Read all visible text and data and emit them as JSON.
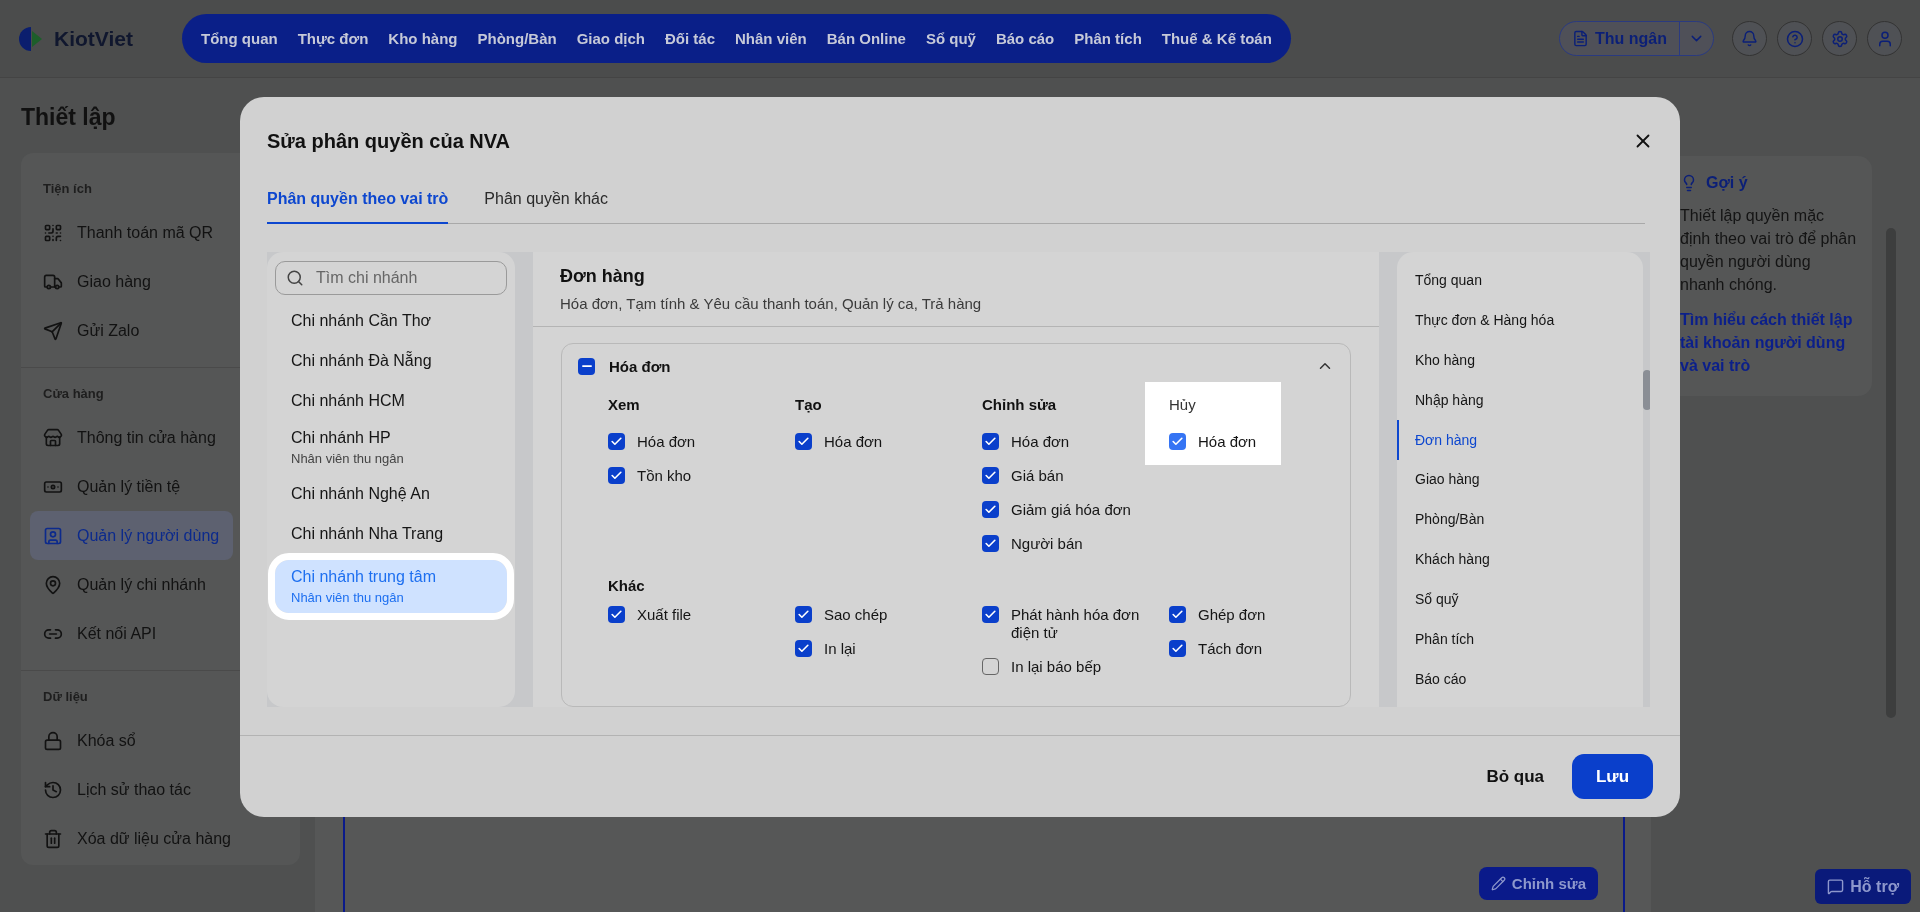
{
  "header": {
    "logo": "KiotViet",
    "nav": [
      "Tổng quan",
      "Thực đơn",
      "Kho hàng",
      "Phòng/Bàn",
      "Giao dịch",
      "Đối tác",
      "Nhân viên",
      "Bán Online",
      "Sổ quỹ",
      "Báo cáo",
      "Phân tích",
      "Thuế & Kế toán"
    ],
    "role_button": "Thu ngân"
  },
  "page": {
    "title": "Thiết lập",
    "sidebar": [
      {
        "title": "Tiện ích",
        "items": [
          {
            "label": "Thanh toán mã QR",
            "selected": false
          },
          {
            "label": "Giao hàng",
            "selected": false
          },
          {
            "label": "Gửi Zalo",
            "selected": false
          }
        ]
      },
      {
        "title": "Cửa hàng",
        "items": [
          {
            "label": "Thông tin cửa hàng",
            "selected": false
          },
          {
            "label": "Quản lý tiền tệ",
            "selected": false
          },
          {
            "label": "Quản lý người dùng",
            "selected": true
          },
          {
            "label": "Quản lý chi nhánh",
            "selected": false
          },
          {
            "label": "Kết nối API",
            "selected": false
          }
        ]
      },
      {
        "title": "Dữ liệu",
        "items": [
          {
            "label": "Khóa sổ",
            "selected": false
          },
          {
            "label": "Lịch sử thao tác",
            "selected": false
          },
          {
            "label": "Xóa dữ liệu cửa hàng",
            "selected": false
          }
        ]
      }
    ],
    "edit_button": "Chỉnh sửa",
    "hint": {
      "title": "Gợi ý",
      "text": "Thiết lập quyền mặc định theo vai trò để phân quyền người dùng nhanh chóng.",
      "link": "Tìm hiểu cách thiết lập tài khoản người dùng và vai trò"
    },
    "support_button": "Hỗ trợ"
  },
  "modal": {
    "title": "Sửa phân quyền của NVA",
    "tabs": [
      {
        "label": "Phân quyền theo vai trò",
        "selected": true
      },
      {
        "label": "Phân quyền khác",
        "selected": false
      }
    ],
    "search": {
      "placeholder": "Tìm chi nhánh"
    },
    "branches": [
      {
        "name": "Chi nhánh Cần Thơ",
        "selected": false
      },
      {
        "name": "Chi nhánh Đà Nẵng",
        "selected": false
      },
      {
        "name": "Chi nhánh HCM",
        "selected": false
      },
      {
        "name": "Chi nhánh HP",
        "role": "Nhân viên thu ngân",
        "selected": false
      },
      {
        "name": "Chi nhánh Nghệ An",
        "selected": false
      },
      {
        "name": "Chi nhánh Nha Trang",
        "selected": false
      },
      {
        "name": "Chi nhánh trung tâm",
        "role": "Nhân viên thu ngân",
        "selected": true
      }
    ],
    "section": {
      "title": "Đơn hàng",
      "subtitle": "Hóa đơn, Tạm tính & Yêu cầu thanh toán, Quản lý ca, Trả hàng"
    },
    "group": {
      "title": "Hóa đơn",
      "indeterminate": true,
      "expanded": true,
      "columns": [
        {
          "title": "Xem",
          "highlighted": false,
          "items": [
            {
              "label": "Hóa đơn",
              "checked": true
            },
            {
              "label": "Tồn kho",
              "checked": true
            }
          ]
        },
        {
          "title": "Tạo",
          "highlighted": false,
          "items": [
            {
              "label": "Hóa đơn",
              "checked": true
            }
          ]
        },
        {
          "title": "Chỉnh sửa",
          "highlighted": false,
          "items": [
            {
              "label": "Hóa đơn",
              "checked": true
            },
            {
              "label": "Giá bán",
              "checked": true
            },
            {
              "label": "Giảm giá hóa đơn",
              "checked": true
            },
            {
              "label": "Người bán",
              "checked": true
            }
          ]
        },
        {
          "title": "Hủy",
          "highlighted": true,
          "items": [
            {
              "label": "Hóa đơn",
              "checked": true
            }
          ]
        }
      ],
      "other": {
        "title": "Khác",
        "columns": [
          [
            {
              "label": "Xuất file",
              "checked": true
            }
          ],
          [
            {
              "label": "Sao chép",
              "checked": true
            },
            {
              "label": "In lại",
              "checked": true
            }
          ],
          [
            {
              "label": "Phát hành hóa đơn điện tử",
              "checked": true
            },
            {
              "label": "In lại báo bếp",
              "checked": false
            }
          ],
          [
            {
              "label": "Ghép đơn",
              "checked": true
            },
            {
              "label": "Tách đơn",
              "checked": true
            }
          ]
        ]
      }
    },
    "nav": [
      {
        "label": "Tổng quan",
        "selected": false
      },
      {
        "label": "Thực đơn & Hàng hóa",
        "selected": false
      },
      {
        "label": "Kho hàng",
        "selected": false
      },
      {
        "label": "Nhập hàng",
        "selected": false
      },
      {
        "label": "Đơn hàng",
        "selected": true
      },
      {
        "label": "Giao hàng",
        "selected": false
      },
      {
        "label": "Phòng/Bàn",
        "selected": false
      },
      {
        "label": "Khách hàng",
        "selected": false
      },
      {
        "label": "Sổ quỹ",
        "selected": false
      },
      {
        "label": "Phân tích",
        "selected": false
      },
      {
        "label": "Báo cáo",
        "selected": false
      }
    ],
    "buttons": {
      "cancel": "Bỏ qua",
      "save": "Lưu"
    }
  }
}
